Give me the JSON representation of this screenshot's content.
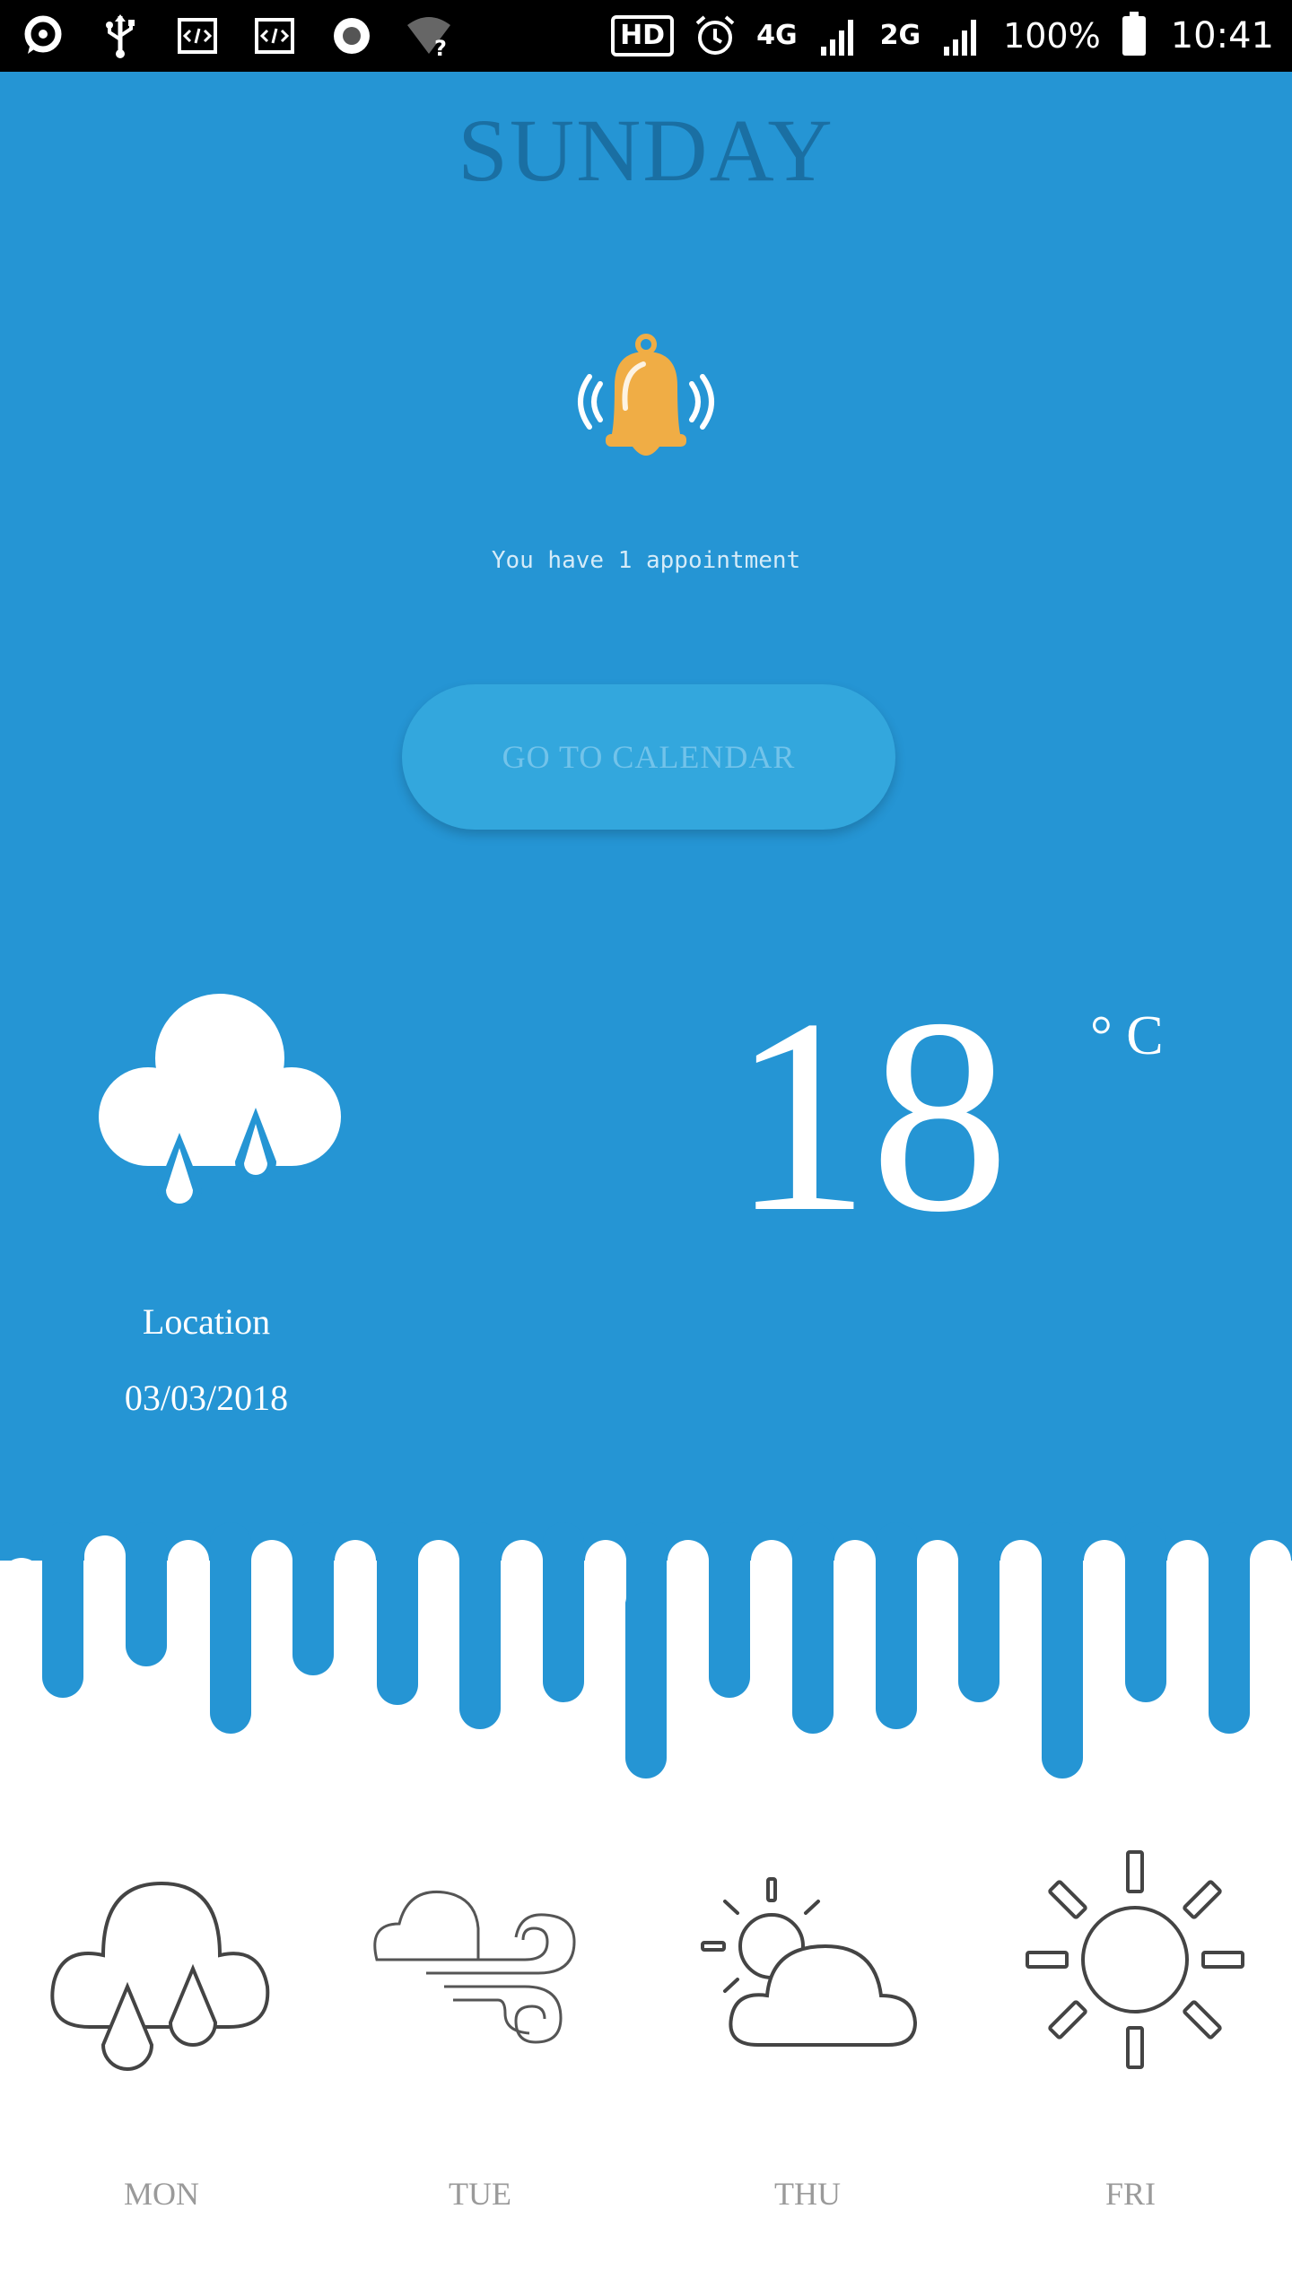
{
  "status_bar": {
    "badge": "HD",
    "network_4g": "4G",
    "network_2g": "2G",
    "battery_percent": "100%",
    "time": "10:41"
  },
  "header": {
    "day": "SUNDAY"
  },
  "notification": {
    "icon": "bell-icon",
    "text": "You have 1 appointment"
  },
  "calendar_button": {
    "label": "GO TO CALENDAR"
  },
  "current_weather": {
    "icon": "cloud-rain-icon",
    "temperature": "18",
    "unit": "° C",
    "location": "Location",
    "date": "03/03/2018"
  },
  "forecast": [
    {
      "day": "MON",
      "icon": "cloud-rain-icon"
    },
    {
      "day": "TUE",
      "icon": "cloud-wind-icon"
    },
    {
      "day": "THU",
      "icon": "partly-cloudy-icon"
    },
    {
      "day": "FRI",
      "icon": "sun-icon"
    }
  ],
  "colors": {
    "primary_blue": "#2595d4",
    "button_blue": "#33a7dd",
    "bell_orange": "#f0ad45",
    "title_dark_blue": "#1a6fa3",
    "forecast_gray": "#9a9a9a"
  }
}
